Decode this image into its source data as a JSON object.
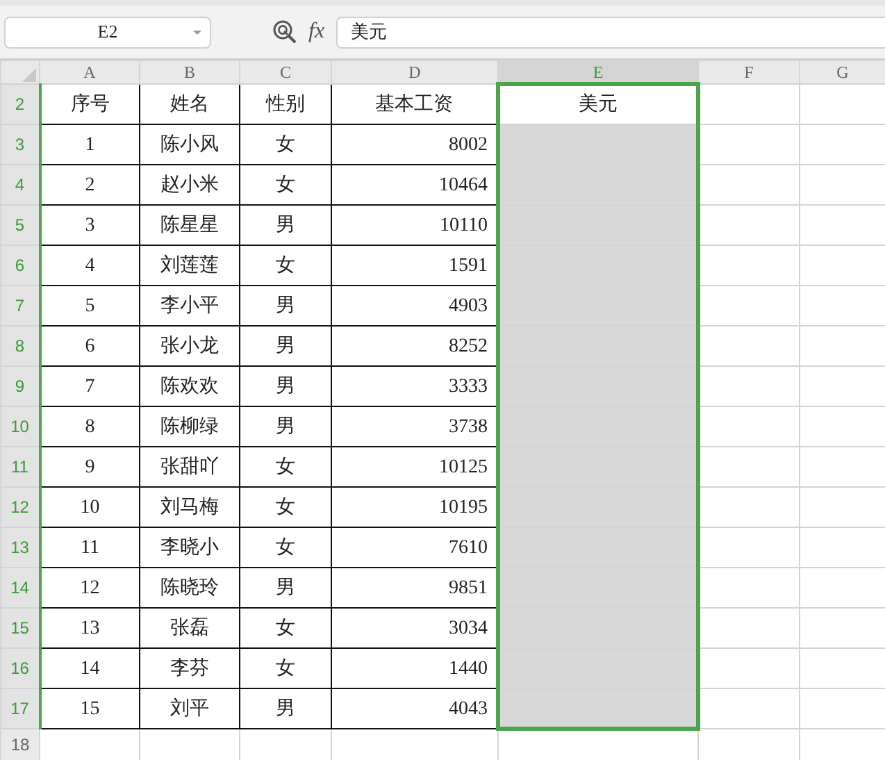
{
  "name_box": {
    "value": "E2"
  },
  "formula_bar": {
    "function_label": "fx",
    "value": "美元"
  },
  "columns": [
    {
      "label": "A",
      "selected": false
    },
    {
      "label": "B",
      "selected": false
    },
    {
      "label": "C",
      "selected": false
    },
    {
      "label": "D",
      "selected": false
    },
    {
      "label": "E",
      "selected": true
    },
    {
      "label": "F",
      "selected": false
    },
    {
      "label": "G",
      "selected": false
    }
  ],
  "rows": [
    {
      "number": "2",
      "selected": true,
      "active": true,
      "cells": [
        "序号",
        "姓名",
        "性别",
        "基本工资",
        "美元"
      ]
    },
    {
      "number": "3",
      "selected": true,
      "active": false,
      "cells": [
        "1",
        "陈小风",
        "女",
        "8002"
      ]
    },
    {
      "number": "4",
      "selected": true,
      "active": false,
      "cells": [
        "2",
        "赵小米",
        "女",
        "10464"
      ]
    },
    {
      "number": "5",
      "selected": true,
      "active": false,
      "cells": [
        "3",
        "陈星星",
        "男",
        "10110"
      ]
    },
    {
      "number": "6",
      "selected": true,
      "active": false,
      "cells": [
        "4",
        "刘莲莲",
        "女",
        "1591"
      ]
    },
    {
      "number": "7",
      "selected": true,
      "active": false,
      "cells": [
        "5",
        "李小平",
        "男",
        "4903"
      ]
    },
    {
      "number": "8",
      "selected": true,
      "active": false,
      "cells": [
        "6",
        "张小龙",
        "男",
        "8252"
      ]
    },
    {
      "number": "9",
      "selected": true,
      "active": false,
      "cells": [
        "7",
        "陈欢欢",
        "男",
        "3333"
      ]
    },
    {
      "number": "10",
      "selected": true,
      "active": false,
      "cells": [
        "8",
        "陈柳绿",
        "男",
        "3738"
      ]
    },
    {
      "number": "11",
      "selected": true,
      "active": false,
      "cells": [
        "9",
        "张甜吖",
        "女",
        "10125"
      ]
    },
    {
      "number": "12",
      "selected": true,
      "active": false,
      "cells": [
        "10",
        "刘马梅",
        "女",
        "10195"
      ]
    },
    {
      "number": "13",
      "selected": true,
      "active": false,
      "cells": [
        "11",
        "李晓小",
        "女",
        "7610"
      ]
    },
    {
      "number": "14",
      "selected": true,
      "active": false,
      "cells": [
        "12",
        "陈晓玲",
        "男",
        "9851"
      ]
    },
    {
      "number": "15",
      "selected": true,
      "active": false,
      "cells": [
        "13",
        "张磊",
        "女",
        "3034"
      ]
    },
    {
      "number": "16",
      "selected": true,
      "active": false,
      "cells": [
        "14",
        "李芬",
        "女",
        "1440"
      ]
    },
    {
      "number": "17",
      "selected": true,
      "active": false,
      "cells": [
        "15",
        "刘平",
        "男",
        "4043"
      ]
    },
    {
      "number": "18",
      "selected": false,
      "active": false,
      "cells": []
    }
  ]
}
